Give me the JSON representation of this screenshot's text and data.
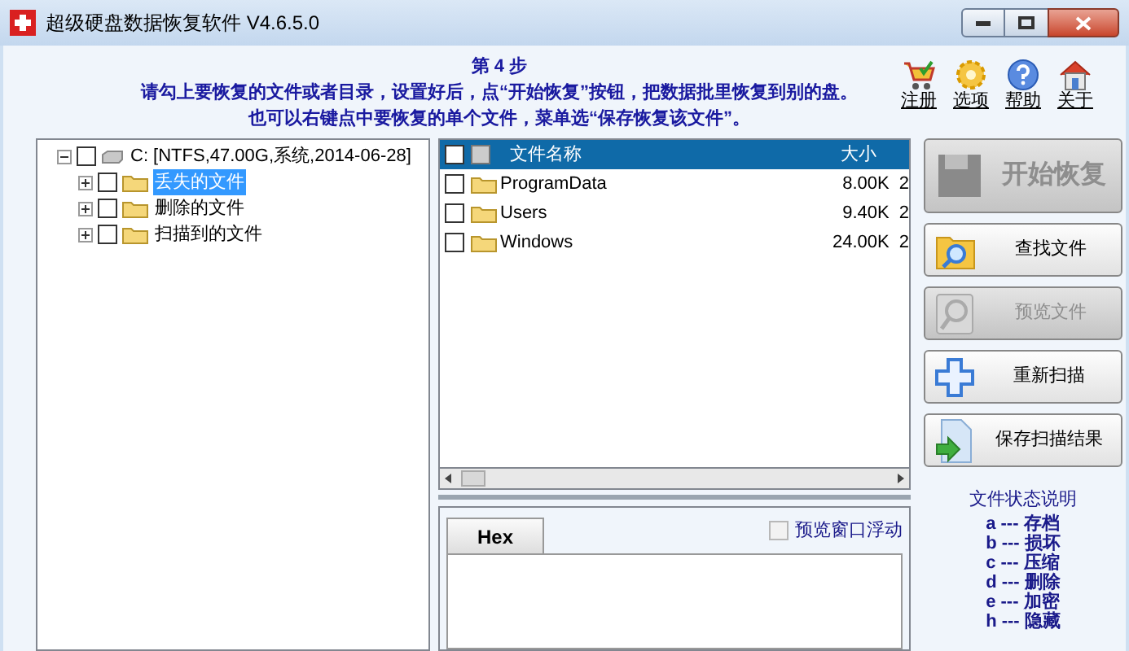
{
  "window": {
    "title": "超级硬盘数据恢复软件 V4.6.5.0"
  },
  "header": {
    "step": "第 4 步",
    "lines": [
      "请勾上要恢复的文件或者目录，设置好后，点“开始恢复”按钮，把数据批里恢复到别的盘。",
      "也可以右键点中要恢复的单个文件，菜单选“保存恢复该文件”。"
    ]
  },
  "toolbar": [
    {
      "kind": "cart",
      "label": "注册"
    },
    {
      "kind": "gear",
      "label": "选项"
    },
    {
      "kind": "help",
      "label": "帮助"
    },
    {
      "kind": "home",
      "label": "关于"
    }
  ],
  "tree": [
    {
      "label": "C:  [NTFS,47.00G,系统,2014-06-28]",
      "kind": "drive",
      "checked": false,
      "selected": false,
      "expanded": true,
      "children": [
        {
          "label": "丢失的文件",
          "kind": "folder",
          "checked": false,
          "selected": true,
          "expanded": false
        },
        {
          "label": "删除的文件",
          "kind": "folder",
          "checked": false,
          "selected": false,
          "expanded": false
        },
        {
          "label": "扫描到的文件",
          "kind": "folder",
          "checked": false,
          "selected": false,
          "expanded": false
        }
      ]
    }
  ],
  "file_list": {
    "all_checked": false,
    "columns": [
      "文件名称",
      "大小"
    ],
    "rows": [
      {
        "name": "ProgramData",
        "size": "8.00K",
        "column_3": "2",
        "checked": false
      },
      {
        "name": "Users",
        "size": "9.40K",
        "column_3": "2",
        "checked": false
      },
      {
        "name": "Windows",
        "size": "24.00K",
        "column_3": "2",
        "checked": false
      }
    ]
  },
  "preview": {
    "tab": "Hex",
    "float_option": {
      "label": "预览窗口浮动",
      "checked": false
    }
  },
  "actions": [
    {
      "kind": "start",
      "label": "开始恢复",
      "disabled": true
    },
    {
      "kind": "find",
      "label": "查找文件",
      "disabled": false
    },
    {
      "kind": "preview",
      "label": "预览文件",
      "disabled": true
    },
    {
      "kind": "rescan",
      "label": "重新扫描",
      "disabled": false
    },
    {
      "kind": "save",
      "label": "保存扫描结果",
      "disabled": false
    }
  ],
  "legend": {
    "title": "文件状态说明",
    "items": [
      "a --- 存档",
      "b --- 损坏",
      "c --- 压缩",
      "d --- 删除",
      "e --- 加密",
      "h --- 隐藏"
    ]
  }
}
